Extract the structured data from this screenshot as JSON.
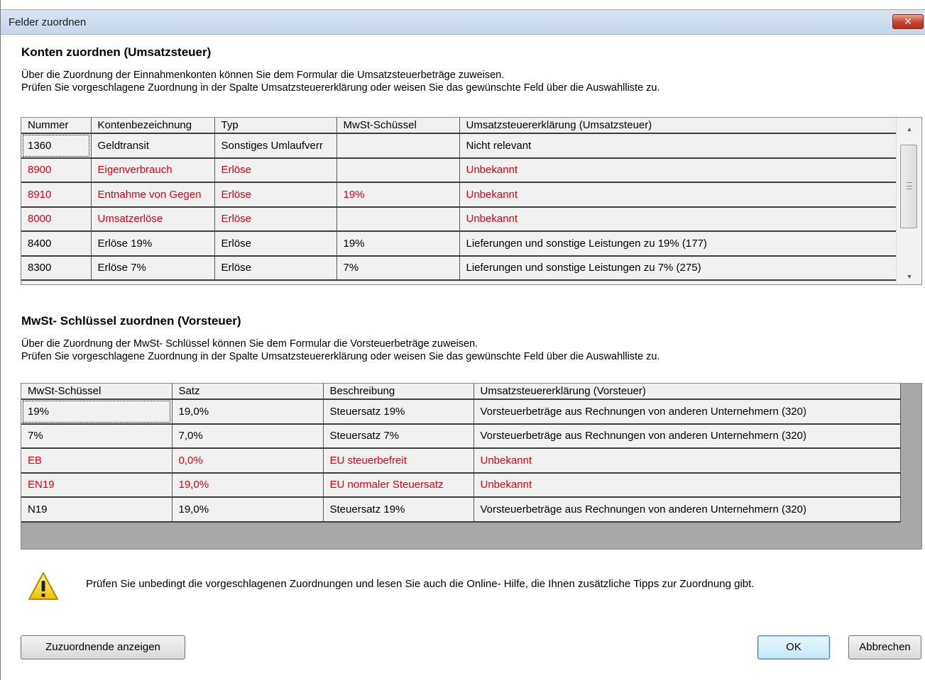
{
  "window": {
    "title": "Felder zuordnen",
    "close_label": "✕"
  },
  "section1": {
    "title": "Konten zuordnen (Umsatzsteuer)",
    "desc_line1": "Über die Zuordnung der Einnahmenkonten können Sie dem Formular die Umsatzsteuerbeträge zuweisen.",
    "desc_line2": "Prüfen Sie vorgeschlagene Zuordnung in der Spalte Umsatzsteuererklärung oder weisen Sie das gewünschte Feld über die Auswahlliste zu.",
    "columns": [
      "Nummer",
      "Kontenbezeichnung",
      "Typ",
      "MwSt-Schüssel",
      "Umsatzsteuererklärung (Umsatzsteuer)"
    ],
    "rows": [
      {
        "highlight": false,
        "cells": [
          "1360",
          "Geldtransit",
          "Sonstiges Umlaufverr",
          "",
          "Nicht relevant"
        ]
      },
      {
        "highlight": true,
        "cells": [
          "8900",
          "Eigenverbrauch",
          "Erlöse",
          "",
          "Unbekannt"
        ]
      },
      {
        "highlight": true,
        "cells": [
          "8910",
          "Entnahme von Gegen",
          "Erlöse",
          "19%",
          "Unbekannt"
        ]
      },
      {
        "highlight": true,
        "cells": [
          "8000",
          "Umsatzerlöse",
          "Erlöse",
          "",
          "Unbekannt"
        ]
      },
      {
        "highlight": false,
        "cells": [
          "8400",
          "Erlöse 19%",
          "Erlöse",
          "19%",
          "Lieferungen und sonstige Leistungen zu 19% (177)"
        ]
      },
      {
        "highlight": false,
        "cells": [
          "8300",
          "Erlöse 7%",
          "Erlöse",
          "7%",
          "Lieferungen und sonstige Leistungen zu 7% (275)"
        ]
      }
    ]
  },
  "section2": {
    "title": "MwSt- Schlüssel zuordnen (Vorsteuer)",
    "desc_line1": "Über die Zuordnung der MwSt- Schlüssel  können Sie dem Formular die Vorsteuerbeträge zuweisen.",
    "desc_line2": "Prüfen Sie vorgeschlagene Zuordnung in der Spalte Umsatzsteuererklärung oder weisen Sie das gewünschte Feld über die Auswahlliste zu.",
    "columns": [
      "MwSt-Schüssel",
      "Satz",
      "Beschreibung",
      "Umsatzsteuererklärung (Vorsteuer)"
    ],
    "rows": [
      {
        "highlight": false,
        "cells": [
          "19%",
          "19,0%",
          "Steuersatz 19%",
          "Vorsteuerbeträge aus Rechnungen von anderen Unternehmern (320)"
        ]
      },
      {
        "highlight": false,
        "cells": [
          "7%",
          "7,0%",
          "Steuersatz 7%",
          "Vorsteuerbeträge aus Rechnungen von anderen Unternehmern (320)"
        ]
      },
      {
        "highlight": true,
        "cells": [
          "EB",
          "0,0%",
          "EU steuerbefreit",
          "Unbekannt"
        ]
      },
      {
        "highlight": true,
        "cells": [
          "EN19",
          "19,0%",
          "EU normaler Steuersatz",
          "Unbekannt"
        ]
      },
      {
        "highlight": false,
        "cells": [
          "N19",
          "19,0%",
          "Steuersatz 19%",
          "Vorsteuerbeträge aus Rechnungen von anderen Unternehmern (320)"
        ]
      }
    ]
  },
  "warning": {
    "icon": "warning-icon",
    "text": "Prüfen Sie unbedingt die vorgeschlagenen Zuordnungen und lesen Sie auch die Online- Hilfe, die Ihnen zusätzliche Tipps zur Zuordnung gibt."
  },
  "buttons": {
    "show_unassigned": "Zuzuordnende anzeigen",
    "ok": "OK",
    "cancel": "Abbrechen"
  },
  "colors": {
    "highlight_text": "#e8000b"
  }
}
